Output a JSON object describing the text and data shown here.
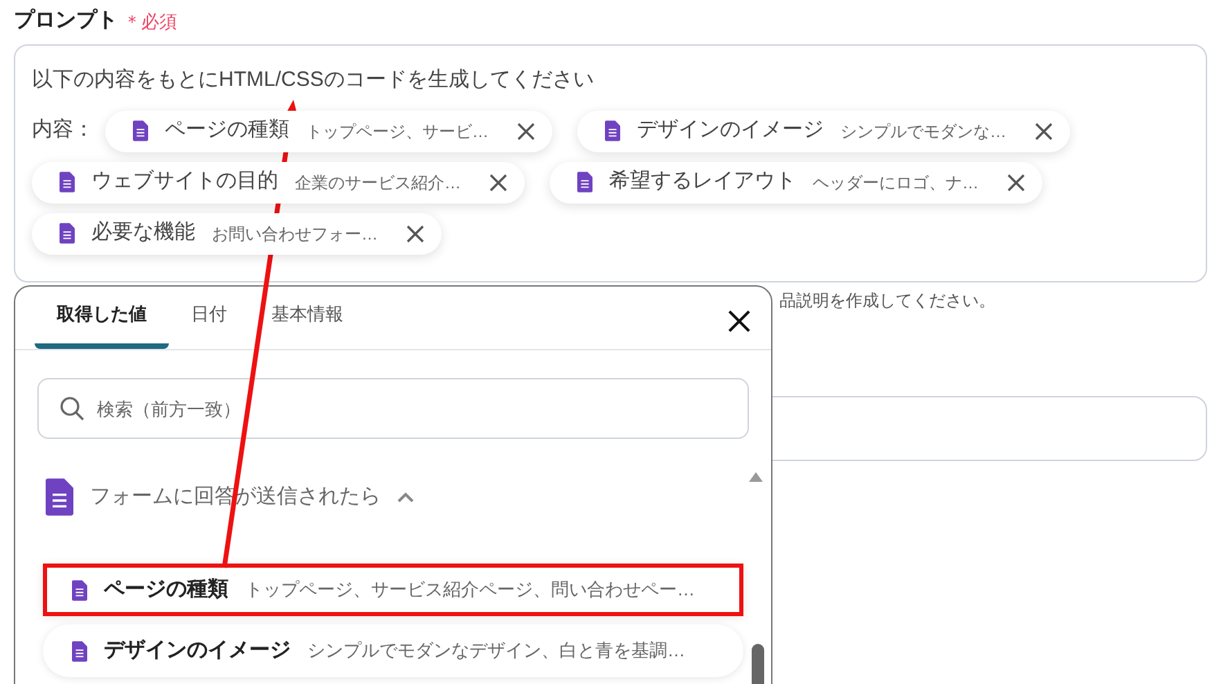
{
  "field": {
    "label": "プロンプト",
    "required_mark": "＊必須"
  },
  "prompt": {
    "text": "以下の内容をもとにHTML/CSSのコードを生成してください",
    "prefix": "内容：",
    "chips": [
      {
        "label": "ページの種類",
        "value": "トップページ、サービ…"
      },
      {
        "label": "デザインのイメージ",
        "value": "シンプルでモダンな…"
      },
      {
        "label": "ウェブサイトの目的",
        "value": "企業のサービス紹介…"
      },
      {
        "label": "希望するレイアウト",
        "value": "ヘッダーにロゴ、ナ…"
      },
      {
        "label": "必要な機能",
        "value": "お問い合わせフォー…"
      }
    ]
  },
  "helper_text": "品説明を作成してください。",
  "popup": {
    "tabs": [
      {
        "label": "取得した値",
        "selected": true
      },
      {
        "label": "日付",
        "selected": false
      },
      {
        "label": "基本情報",
        "selected": false
      }
    ],
    "search": {
      "placeholder": "検索（前方一致）"
    },
    "group": {
      "title": "フォームに回答が送信されたら",
      "expanded": true
    },
    "items": [
      {
        "label": "ページの種類",
        "value": "トップページ、サービス紹介ページ、問い合わせペー…",
        "highlighted": true
      },
      {
        "label": "デザインのイメージ",
        "value": "シンプルでモダンなデザイン、白と青を基調…",
        "highlighted": false
      }
    ]
  }
}
